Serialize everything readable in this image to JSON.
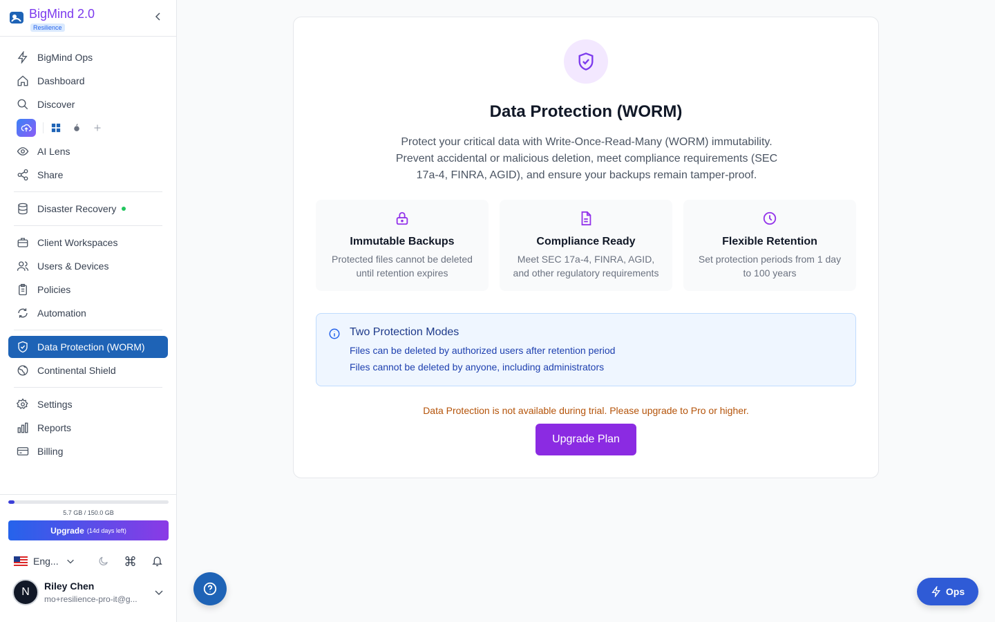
{
  "brand": {
    "name": "BigMind 2.0",
    "badge": "Resilience"
  },
  "nav": {
    "ops": "BigMind Ops",
    "dashboard": "Dashboard",
    "discover": "Discover",
    "ai_lens": "AI Lens",
    "share": "Share",
    "disaster_recovery": "Disaster Recovery",
    "client_workspaces": "Client Workspaces",
    "users_devices": "Users & Devices",
    "policies": "Policies",
    "automation": "Automation",
    "data_protection": "Data Protection (WORM)",
    "continental_shield": "Continental Shield",
    "settings": "Settings",
    "reports": "Reports",
    "billing": "Billing"
  },
  "storage": {
    "text": "5.7 GB / 150.0 GB",
    "used_fraction": 0.038
  },
  "upgrade_side": {
    "label": "Upgrade",
    "days_left": "(14d days left)"
  },
  "language": "Eng...",
  "user": {
    "initial": "N",
    "name": "Riley Chen",
    "email": "mo+resilience-pro-it@g..."
  },
  "main": {
    "title": "Data Protection (WORM)",
    "description": "Protect your critical data with Write-Once-Read-Many (WORM) immutability. Prevent accidental or malicious deletion, meet compliance requirements (SEC 17a-4, FINRA, AGID), and ensure your backups remain tamper-proof.",
    "features": [
      {
        "icon": "lock-icon",
        "title": "Immutable Backups",
        "text": "Protected files cannot be deleted until retention expires"
      },
      {
        "icon": "document-icon",
        "title": "Compliance Ready",
        "text": "Meet SEC 17a-4, FINRA, AGID, and other regulatory requirements"
      },
      {
        "icon": "clock-icon",
        "title": "Flexible Retention",
        "text": "Set protection periods from 1 day to 100 years"
      }
    ],
    "info": {
      "title": "Two Protection Modes",
      "lines": [
        "Files can be deleted by authorized users after retention period",
        "Files cannot be deleted by anyone, including administrators"
      ]
    },
    "warning": "Data Protection is not available during trial. Please upgrade to Pro or higher.",
    "upgrade_button": "Upgrade Plan"
  },
  "ops_button": "Ops",
  "colors": {
    "accent": "#8b2be2",
    "primary": "#1e63b6",
    "warning": "#b45309"
  }
}
